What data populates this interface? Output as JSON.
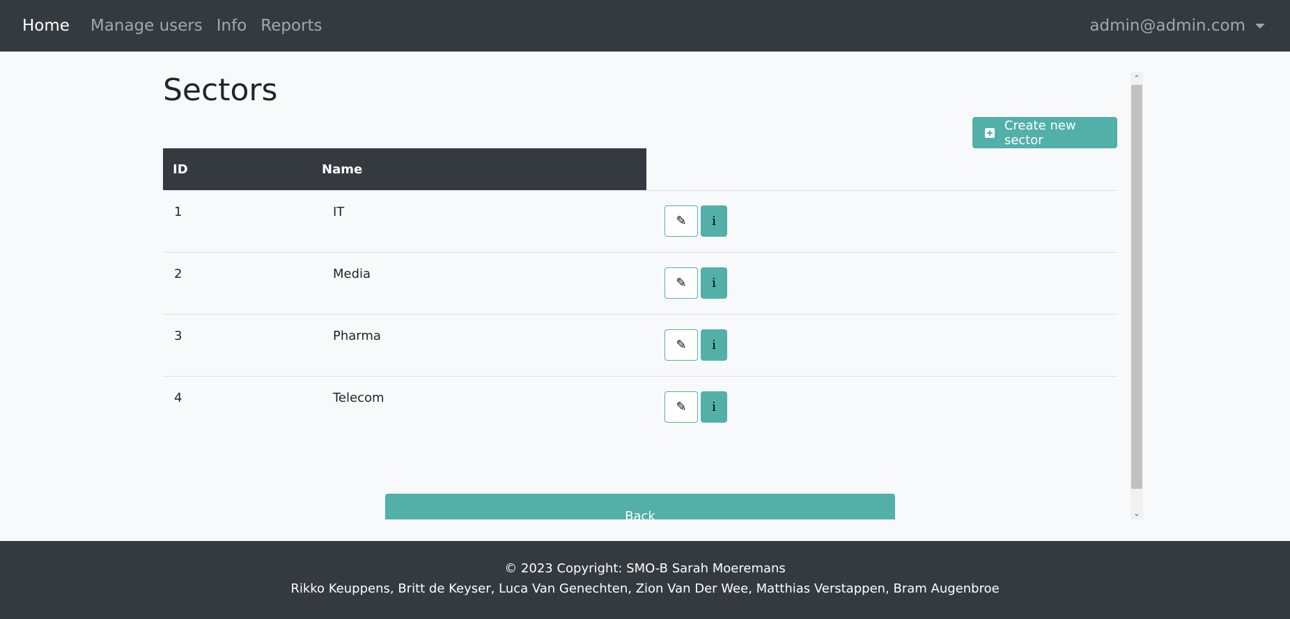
{
  "navbar": {
    "brand": "Home",
    "links": [
      "Manage users",
      "Info",
      "Reports"
    ],
    "user": "admin@admin.com"
  },
  "page": {
    "title": "Sectors",
    "create_button": "Create new sector",
    "back_button": "Back"
  },
  "table": {
    "headers": [
      "ID",
      "Name"
    ],
    "rows": [
      {
        "id": "1",
        "name": "IT"
      },
      {
        "id": "2",
        "name": "Media"
      },
      {
        "id": "3",
        "name": "Pharma"
      },
      {
        "id": "4",
        "name": "Telecom"
      }
    ],
    "edit_icon": "✎",
    "info_icon": "i"
  },
  "footer": {
    "copyright": "© 2023 Copyright: SMO-B Sarah Moeremans",
    "authors": "Rikko Keuppens, Britt de Keyser, Luca Van Genechten, Zion Van Der Wee, Matthias Verstappen, Bram Augenbroe"
  },
  "colors": {
    "navbar_bg": "#343a40",
    "accent": "#52b0a9",
    "page_bg": "#f8f9fa"
  }
}
